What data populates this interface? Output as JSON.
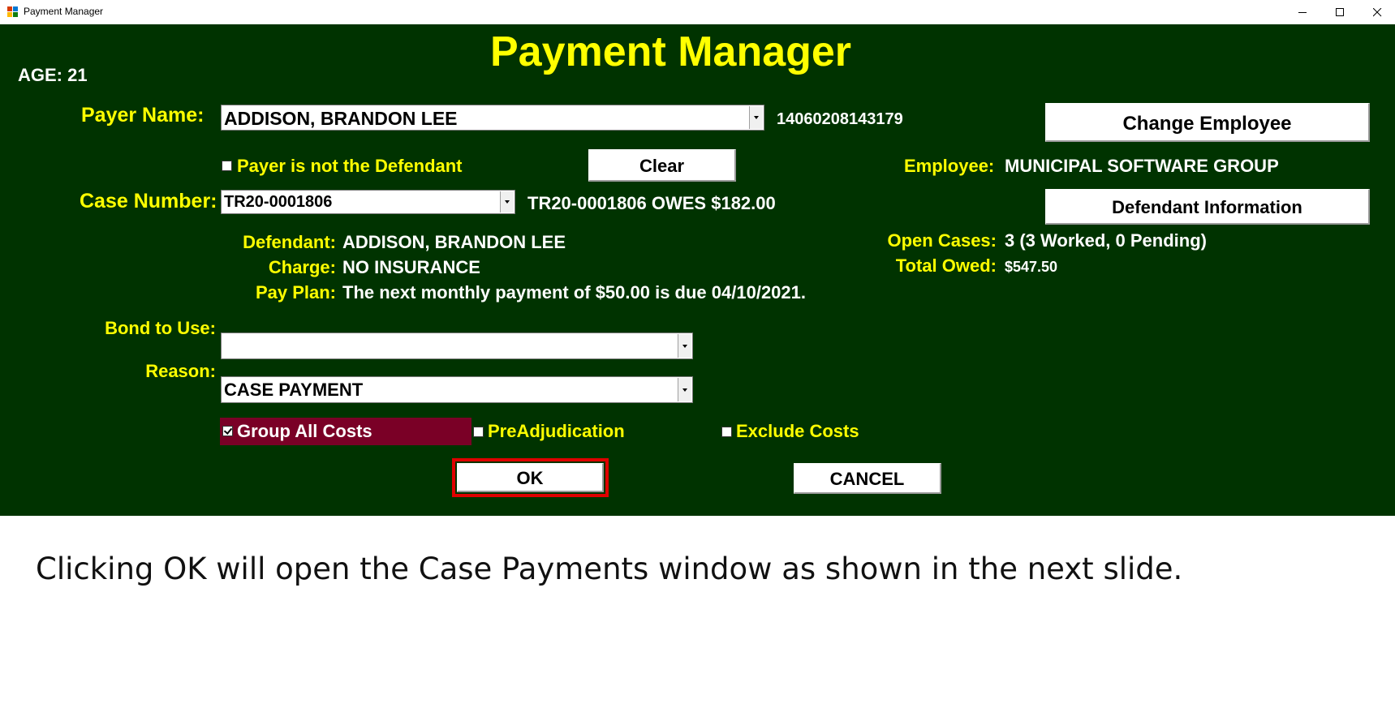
{
  "window": {
    "title": "Payment Manager",
    "controls": [
      "minimize-icon",
      "maximize-icon",
      "close-icon"
    ]
  },
  "form": {
    "heading": "Payment Manager",
    "age": "AGE: 21",
    "payer_name_label": "Payer Name:",
    "payer_name_value": "ADDISON, BRANDON LEE",
    "payer_id": "14060208143179",
    "payer_not_defendant_label": "Payer is not the Defendant",
    "payer_not_defendant_checked": false,
    "clear_button": "Clear",
    "change_employee_button": "Change Employee",
    "employee_label": "Employee:",
    "employee_value": "MUNICIPAL SOFTWARE GROUP",
    "case_number_label": "Case Number:",
    "case_number_value": "TR20-0001806",
    "case_owes": "TR20-0001806 OWES $182.00",
    "defendant_info_button": "Defendant Information",
    "defendant_label": "Defendant:",
    "defendant_value": "ADDISON, BRANDON LEE",
    "charge_label": "Charge:",
    "charge_value": "NO INSURANCE",
    "pay_plan_label": "Pay Plan:",
    "pay_plan_value": "The next monthly payment of $50.00 is due 04/10/2021.",
    "open_cases_label": "Open Cases:",
    "open_cases_value": "3 (3 Worked, 0 Pending)",
    "total_owed_label": "Total Owed:",
    "total_owed_value": "$547.50",
    "bond_label": "Bond to Use:",
    "bond_value": "",
    "reason_label": "Reason:",
    "reason_value": "CASE PAYMENT",
    "group_all_costs_label": "Group All Costs",
    "group_all_costs_checked": true,
    "preadjudication_label": "PreAdjudication",
    "preadjudication_checked": false,
    "exclude_costs_label": "Exclude Costs",
    "exclude_costs_checked": false,
    "ok_button": "OK",
    "cancel_button": "CANCEL"
  },
  "caption": "Clicking OK will open the Case Payments window as shown in the next slide.",
  "colors": {
    "form_background": "#003300",
    "label_yellow": "#ffff00",
    "value_white": "#ffffff",
    "highlight_maroon": "#7a0026",
    "ok_outline_red": "#e00000"
  }
}
